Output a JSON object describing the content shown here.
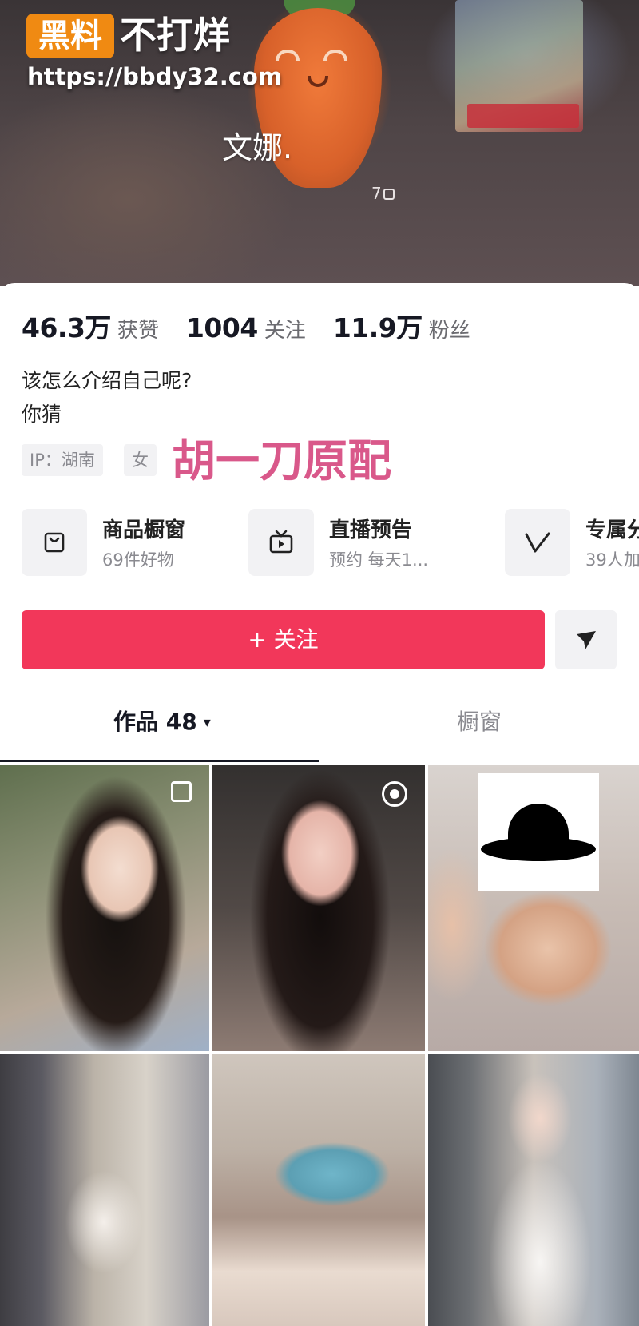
{
  "watermark": {
    "logo_box": "黑料",
    "logo_text": "不打烊",
    "url": "https://bbdy32.com",
    "overlay_text": "胡一刀原配"
  },
  "profile": {
    "nickname": "文娜.",
    "banner_count": "7",
    "stats": [
      {
        "value": "46.3万",
        "label": "获赞"
      },
      {
        "value": "1004",
        "label": "关注"
      },
      {
        "value": "11.9万",
        "label": "粉丝"
      }
    ],
    "bio": [
      "该怎么介绍自己呢?",
      "你猜"
    ],
    "tags": {
      "ip": "IP：湖南",
      "sex": "女"
    }
  },
  "features": [
    {
      "title": "商品橱窗",
      "subtitle": "69件好物",
      "icon": "bag-icon"
    },
    {
      "title": "直播预告",
      "subtitle": "预约 每天1...",
      "icon": "tv-icon"
    },
    {
      "title": "专属分",
      "subtitle": "39人加",
      "icon": "v-icon"
    }
  ],
  "actions": {
    "follow_label": "+ 关注",
    "share_icon": "send-icon"
  },
  "tabs": {
    "works_label": "作品 48",
    "works_caret": "▾",
    "showcase_label": "橱窗"
  },
  "colors": {
    "accent": "#f2375a",
    "watermark_pink": "#d9588a",
    "logo_orange": "#f08a12"
  }
}
